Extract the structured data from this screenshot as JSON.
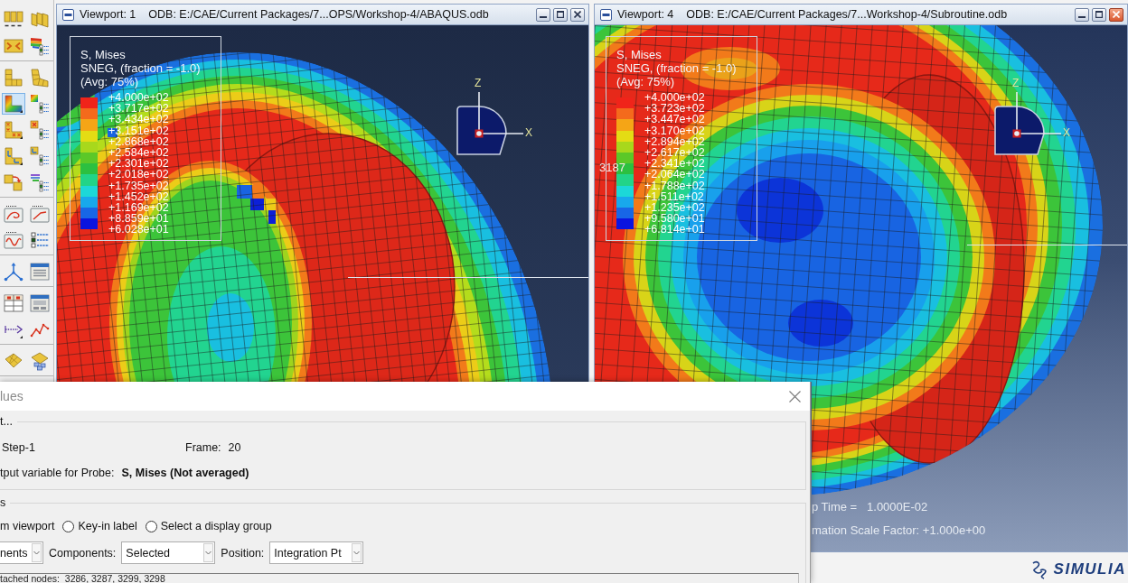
{
  "toolbar": {
    "groups": [
      {
        "tools": [
          {
            "kind": "tiles",
            "selected": false
          },
          {
            "kind": "tilted",
            "selected": false
          },
          {
            "kind": "chevrons",
            "selected": false
          },
          {
            "kind": "layers",
            "selected": false
          }
        ]
      },
      {
        "tools": [
          {
            "kind": "block",
            "selected": false
          },
          {
            "kind": "bent",
            "selected": false
          },
          {
            "kind": "contour",
            "selected": true
          },
          {
            "kind": "gradlist",
            "selected": false
          },
          {
            "kind": "marked",
            "selected": false
          },
          {
            "kind": "marklist",
            "selected": false
          },
          {
            "kind": "axes",
            "selected": false
          },
          {
            "kind": "axeslist",
            "selected": false
          },
          {
            "kind": "swap",
            "selected": false
          },
          {
            "kind": "stacklist",
            "selected": false
          }
        ]
      },
      {
        "tools": [
          {
            "kind": "loop",
            "selected": false
          },
          {
            "kind": "ramp",
            "selected": false
          },
          {
            "kind": "wave",
            "selected": false
          },
          {
            "kind": "checklist",
            "selected": false
          }
        ]
      },
      {
        "tools": [
          {
            "kind": "triad",
            "selected": false
          },
          {
            "kind": "form",
            "selected": false
          }
        ]
      },
      {
        "tools": [
          {
            "kind": "table",
            "selected": false
          },
          {
            "kind": "panel",
            "selected": false
          },
          {
            "kind": "dotted",
            "selected": false
          },
          {
            "kind": "linechart",
            "selected": false
          }
        ]
      },
      {
        "tools": [
          {
            "kind": "sheet",
            "selected": false
          },
          {
            "kind": "sheets",
            "selected": false
          }
        ]
      }
    ]
  },
  "viewports": [
    {
      "kind": "ring",
      "title": "Viewport: 1",
      "odb": "ODB: E:/CAE/Current Packages/7...OPS/Workshop-4/ABAQUS.odb",
      "active": false,
      "legend": {
        "lines": [
          "S, Mises",
          "SNEG, (fraction = -1.0)",
          "(Avg: 75%)"
        ],
        "bands": [
          {
            "color": "#f0241a"
          },
          {
            "color": "#f46a1c"
          },
          {
            "color": "#f5a516"
          },
          {
            "color": "#e4dc14"
          },
          {
            "color": "#a8d81c"
          },
          {
            "color": "#5cc828"
          },
          {
            "color": "#2cc040"
          },
          {
            "color": "#22d488"
          },
          {
            "color": "#1cd8d8"
          },
          {
            "color": "#18a8ec"
          },
          {
            "color": "#1866e6"
          },
          {
            "color": "#0a14e0"
          }
        ],
        "values": [
          "+4.000e+02",
          "+3.717e+02",
          "+3.434e+02",
          "+3.151e+02",
          "+2.868e+02",
          "+2.584e+02",
          "+2.301e+02",
          "+2.018e+02",
          "+1.735e+02",
          "+1.452e+02",
          "+1.169e+02",
          "+8.859e+01",
          "+6.028e+01"
        ]
      },
      "triad": {
        "z": "Z",
        "x": "X"
      }
    },
    {
      "kind": "crater",
      "title": "Viewport: 4",
      "odb": "ODB: E:/CAE/Current Packages/7...Workshop-4/Subroutine.odb",
      "active": true,
      "legend": {
        "lines": [
          "S, Mises",
          "SNEG, (fraction = -1.0)",
          "(Avg: 75%)"
        ],
        "bands": [
          {
            "color": "#f0241a"
          },
          {
            "color": "#f46a1c"
          },
          {
            "color": "#f5a516"
          },
          {
            "color": "#e4dc14"
          },
          {
            "color": "#a8d81c"
          },
          {
            "color": "#5cc828"
          },
          {
            "color": "#2cc040"
          },
          {
            "color": "#22d488"
          },
          {
            "color": "#1cd8d8"
          },
          {
            "color": "#18a8ec"
          },
          {
            "color": "#1866e6"
          },
          {
            "color": "#0a14e0"
          }
        ],
        "values": [
          "+4.000e+02",
          "+3.723e+02",
          "+3.447e+02",
          "+3.170e+02",
          "+2.894e+02",
          "+2.617e+02",
          "+2.341e+02",
          "+2.064e+02",
          "+1.788e+02",
          "+1.511e+02",
          "+1.235e+02",
          "+9.580e+01",
          "+6.814e+01"
        ]
      },
      "triad": {
        "z": "Z",
        "x": "X"
      },
      "node_label": "3187",
      "state_lines": [
        "p Time =   1.0000E-02",
        "mation Scale Factor: +1.000e+00"
      ]
    }
  ],
  "dialog": {
    "title": "lues",
    "output": {
      "title": "t...",
      "step": "Step-1",
      "frame_label": "Frame:",
      "frame_value": "20",
      "probe_label": "tput variable for Probe:",
      "probe_value": "S, Mises (Not averaged)"
    },
    "selection": {
      "title": "s",
      "cut_option": "m viewport",
      "options": [
        {
          "label": "Key-in label",
          "selected": false
        },
        {
          "label": "Select a display group",
          "selected": false
        }
      ],
      "fields": [
        {
          "value": "nents"
        },
        {
          "label": "Components:",
          "value": "Selected"
        },
        {
          "label": "Position:",
          "value": "Integration Pt"
        }
      ],
      "nodes": "tached nodes:  3286, 3287, 3299, 3298"
    }
  },
  "logo": {
    "text": "SIMULIA"
  }
}
